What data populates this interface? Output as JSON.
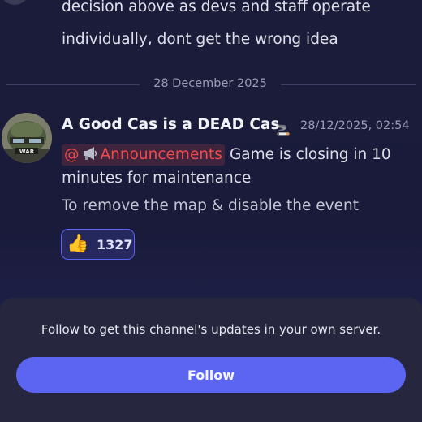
{
  "previous_message": {
    "line1": "decision above as devs and staff operate",
    "line2": "individually, dont get the wrong idea"
  },
  "date_divider": "28 December 2025",
  "message": {
    "author": "A Good Cas is a DEAD Cas",
    "author_emoji": "🚬",
    "timestamp": "28/12/2025, 02:54",
    "mention_at": "@",
    "mention_icon": "megaphone-icon",
    "mention_name": "Announcements",
    "text_line1": "Game is closing in 10",
    "text_line2": "minutes for maintenance",
    "text_line3": "To remove the map & disable the event",
    "reaction": {
      "emoji": "👍",
      "count": "1327"
    },
    "avatar_caption": "WAR"
  },
  "follow_panel": {
    "message": "Follow to get this channel's updates in your own server.",
    "button_label": "Follow"
  },
  "colors": {
    "background": "#1b1c3a",
    "mention": "#f04a4a",
    "accent": "#5c64f2",
    "panel": "#26273f"
  }
}
